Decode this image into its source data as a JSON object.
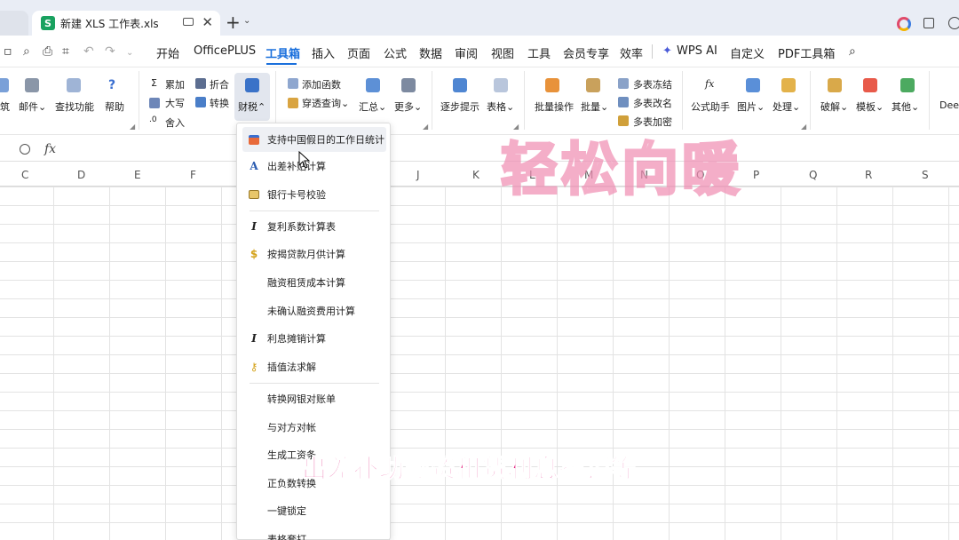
{
  "titlebar": {
    "doc_tab_icon": "S",
    "doc_tab_title": "新建 XLS 工作表.xls",
    "close_glyph": "✕",
    "new_tab_glyph": "+",
    "caret_glyph": "⌄"
  },
  "menubar": {
    "items": [
      "开始",
      "OfficePLUS",
      "工具箱",
      "插入",
      "页面",
      "公式",
      "数据",
      "审阅",
      "视图",
      "工具",
      "会员专享",
      "效率",
      "WPS AI",
      "自定义",
      "PDF工具箱"
    ],
    "active_item": "工具箱"
  },
  "ribbon": {
    "col1_label": "筑",
    "mail_label": "邮件",
    "find_label": "查找功能",
    "help_label": "帮助",
    "leijia_label": "累加",
    "daxie_label": "大写",
    "sheru_label": "舍入",
    "zhehe_label": "折合",
    "zhuanhuan_label": "转换",
    "caishui_label": "财税",
    "add_func_label": "添加函数",
    "chuantou_label": "穿透查询",
    "huizong_label": "汇总",
    "more_label": "更多",
    "step_label": "逐步提示",
    "table_label": "表格",
    "batch_op_label": "批量操作",
    "batch_label": "批量",
    "freeze_label": "多表冻结",
    "rename_label": "多表改名",
    "encrypt_label": "多表加密",
    "formula_helper_label": "公式助手",
    "picture_label": "图片",
    "process_label": "处理",
    "crack_label": "破解",
    "template_label": "模板",
    "other_label": "其他",
    "deep_label": "Deep"
  },
  "formula_bar": {
    "fx_label": "fx"
  },
  "columns": [
    "C",
    "D",
    "E",
    "F",
    "J",
    "K",
    "L",
    "M",
    "N",
    "O",
    "P",
    "Q",
    "R",
    "S"
  ],
  "watermark_text": "轻松向暖",
  "dropdown": {
    "items": [
      {
        "label": "支持中国假日的工作日统计",
        "icon": "calendar-icon"
      },
      {
        "label": "出差补贴计算",
        "icon": "letter-a-icon"
      },
      {
        "label": "银行卡号校验",
        "icon": "card-icon"
      },
      {
        "label": "复利系数计算表",
        "icon": "italic-i-icon"
      },
      {
        "label": "按揭贷款月供计算",
        "icon": "dollar-icon"
      },
      {
        "label": "融资租赁成本计算",
        "icon": ""
      },
      {
        "label": "未确认融资费用计算",
        "icon": ""
      },
      {
        "label": "利息摊销计算",
        "icon": "italic-i-icon"
      },
      {
        "label": "插值法求解",
        "icon": "key-icon"
      },
      {
        "label": "转换网银对账单",
        "icon": ""
      },
      {
        "label": "与对方对帐",
        "icon": ""
      },
      {
        "label": "生成工资条",
        "icon": ""
      },
      {
        "label": "正负数转换",
        "icon": ""
      },
      {
        "label": "一键锁定",
        "icon": ""
      },
      {
        "label": "表格套打",
        "icon": ""
      }
    ]
  },
  "subtitle_text": "出差补助融资租赁利息摊销等",
  "colors": {
    "accent": "#1a6fdc",
    "subtitle": "#e01b7a",
    "watermark_stroke": "#f08fb4",
    "xls_green": "#1aa260"
  }
}
